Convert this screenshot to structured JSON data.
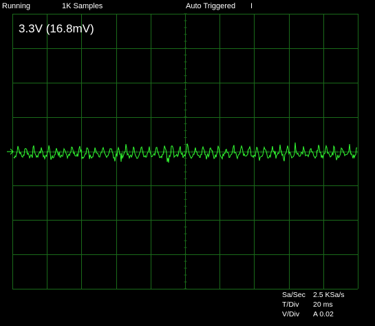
{
  "status_bar": {
    "run_state": "Running",
    "sample_count": "1K Samples",
    "trigger_state": "Auto Triggered",
    "cursor_marker": "I"
  },
  "trace_label": "3.3V (16.8mV)",
  "readouts": {
    "sample_rate_label": "Sa/Sec",
    "sample_rate_value": "2.5 KSa/s",
    "time_div_label": "T/Div",
    "time_div_value": "20 ms",
    "volt_div_label": "V/Div",
    "volt_div_value": "A 0.02"
  },
  "colors": {
    "background": "#000000",
    "grid": "#1a6b1a",
    "trace": "#33ff33",
    "text": "#ffffff"
  },
  "icons": {
    "channel_marker": "arrow-right-icon"
  }
}
